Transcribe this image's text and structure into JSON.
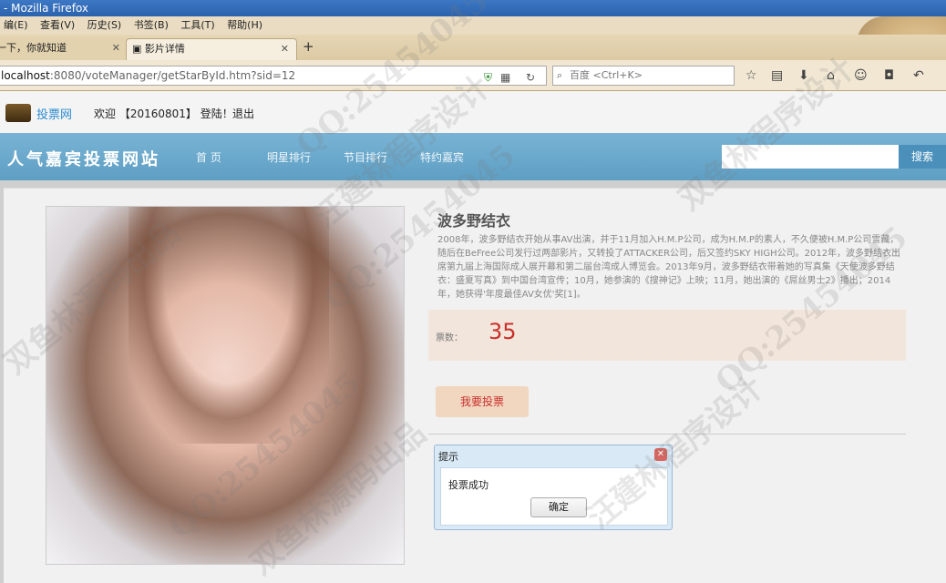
{
  "browser": {
    "window_title": "- Mozilla Firefox",
    "menu": [
      "编(E)",
      "查看(V)",
      "历史(S)",
      "书签(B)",
      "工具(T)",
      "帮助(H)"
    ],
    "tabs": [
      {
        "label": "一下，你就知道"
      },
      {
        "label": "影片详情"
      }
    ],
    "url_host": "localhost",
    "url_rest": ":8080/voteManager/getStarById.htm?sid=12",
    "search_placeholder": "百度 <Ctrl+K>"
  },
  "site": {
    "logo_text": "投票网",
    "welcome": "欢迎 【20160801】 登陆！",
    "logout": "退出",
    "title": "人气嘉宾投票网站",
    "nav": [
      "首 页",
      "明星排行",
      "节目排行",
      "特约嘉宾"
    ],
    "search_button": "搜索"
  },
  "star": {
    "name": "波多野结衣",
    "description": "2008年，波多野结衣开始从事AV出演，并于11月加入H.M.P公司，成为H.M.P的素人，不久便被H.M.P公司雪藏，随后在BeFree公司发行过两部影片，又转投了ATTACKER公司，后又签约SKY HIGH公司。2012年，波多野结衣出席第九届上海国际成人展开幕和第二届台湾成人博览会。2013年9月，波多野结衣带着她的写真集《天使波多野结衣：盛夏写真》到中国台湾宣传；10月，她参演的《搜神记》上映；11月，她出演的《屌丝男士2》播出；2014年，她获得'年度最佳AV女优'奖[1]。",
    "vote_label": "票数：",
    "vote_count": "35",
    "vote_button": "我要投票"
  },
  "dialog": {
    "title": "提示",
    "message": "投票成功",
    "ok": "确定"
  },
  "watermark": {
    "qq": "QQ:25454045",
    "qq2": "QQ:25454045",
    "qq3": "QQ:25454045",
    "qq4": "QQ:25454045",
    "name1": "双鱼林程序设计",
    "name2": "双鱼林源码出品",
    "name3": "汪建林程序设计",
    "name4": "双鱼林源码出品",
    "name5": "汪建林程序设计"
  }
}
